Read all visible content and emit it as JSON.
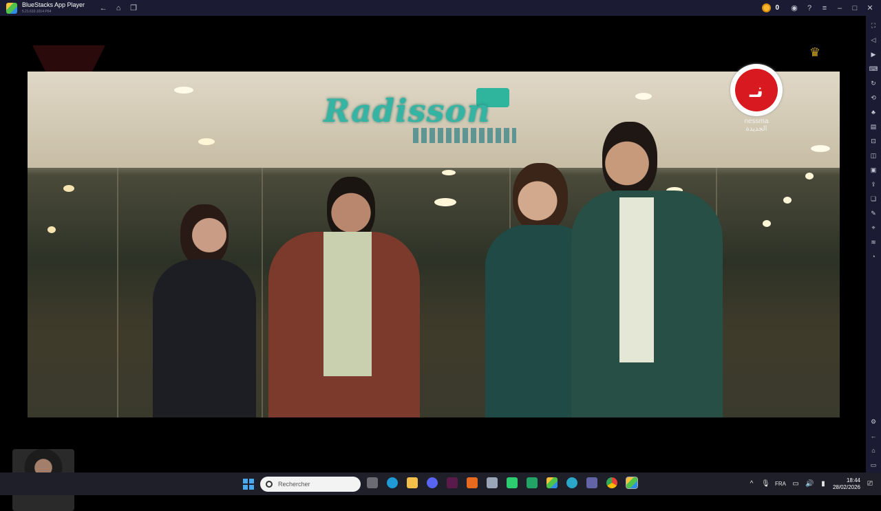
{
  "window": {
    "app_name": "BlueStacks App Player",
    "version": "5.21.610.1014  P64",
    "coins": "0"
  },
  "video": {
    "sign_text": "Radisson",
    "channel_name_latin": "nessma",
    "channel_name_arabic": "الجديدة",
    "channel_logo_glyph": "نـ"
  },
  "taskbar": {
    "search_placeholder": "Rechercher",
    "language": "FRA",
    "time": "18:44",
    "date": "28/02/2026"
  },
  "colors": {
    "titlebar": "#1b1c33",
    "taskbar": "#1f1f2a",
    "nessma_red": "#d81920"
  }
}
